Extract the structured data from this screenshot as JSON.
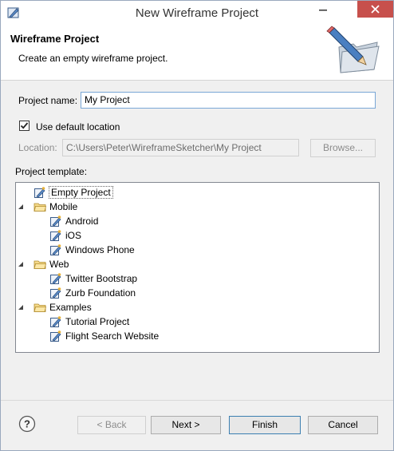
{
  "window": {
    "title": "New Wireframe Project",
    "app_icon": "wireframe-app-icon",
    "minimize_icon": "minimize-icon",
    "close_icon": "close-icon"
  },
  "banner": {
    "title": "Wireframe Project",
    "description": "Create an empty wireframe project.",
    "art_icon": "pencil-folder-icon"
  },
  "form": {
    "project_name_label": "Project name:",
    "project_name_value": "My Project",
    "use_default_label": "Use default location",
    "use_default_checked": true,
    "location_label": "Location:",
    "location_value": "C:\\Users\\Peter\\WireframeSketcher\\My Project",
    "browse_label": "Browse..."
  },
  "template": {
    "label": "Project template:",
    "items": [
      {
        "label": "Empty Project",
        "level": 0,
        "type": "project",
        "expandable": false,
        "selected": true
      },
      {
        "label": "Mobile",
        "level": 0,
        "type": "folder",
        "expandable": true,
        "expanded": true
      },
      {
        "label": "Android",
        "level": 1,
        "type": "project"
      },
      {
        "label": "iOS",
        "level": 1,
        "type": "project"
      },
      {
        "label": "Windows Phone",
        "level": 1,
        "type": "project"
      },
      {
        "label": "Web",
        "level": 0,
        "type": "folder",
        "expandable": true,
        "expanded": true
      },
      {
        "label": "Twitter Bootstrap",
        "level": 1,
        "type": "project"
      },
      {
        "label": "Zurb Foundation",
        "level": 1,
        "type": "project"
      },
      {
        "label": "Examples",
        "level": 0,
        "type": "folder",
        "expandable": true,
        "expanded": true
      },
      {
        "label": "Tutorial Project",
        "level": 1,
        "type": "project"
      },
      {
        "label": "Flight Search Website",
        "level": 1,
        "type": "project"
      }
    ]
  },
  "buttons": {
    "help_icon": "help-icon",
    "back": "< Back",
    "next": "Next >",
    "finish": "Finish",
    "cancel": "Cancel"
  },
  "colors": {
    "close_button": "#c7504c",
    "focus_border": "#7aa7d6",
    "folder": "#e8c46a"
  }
}
